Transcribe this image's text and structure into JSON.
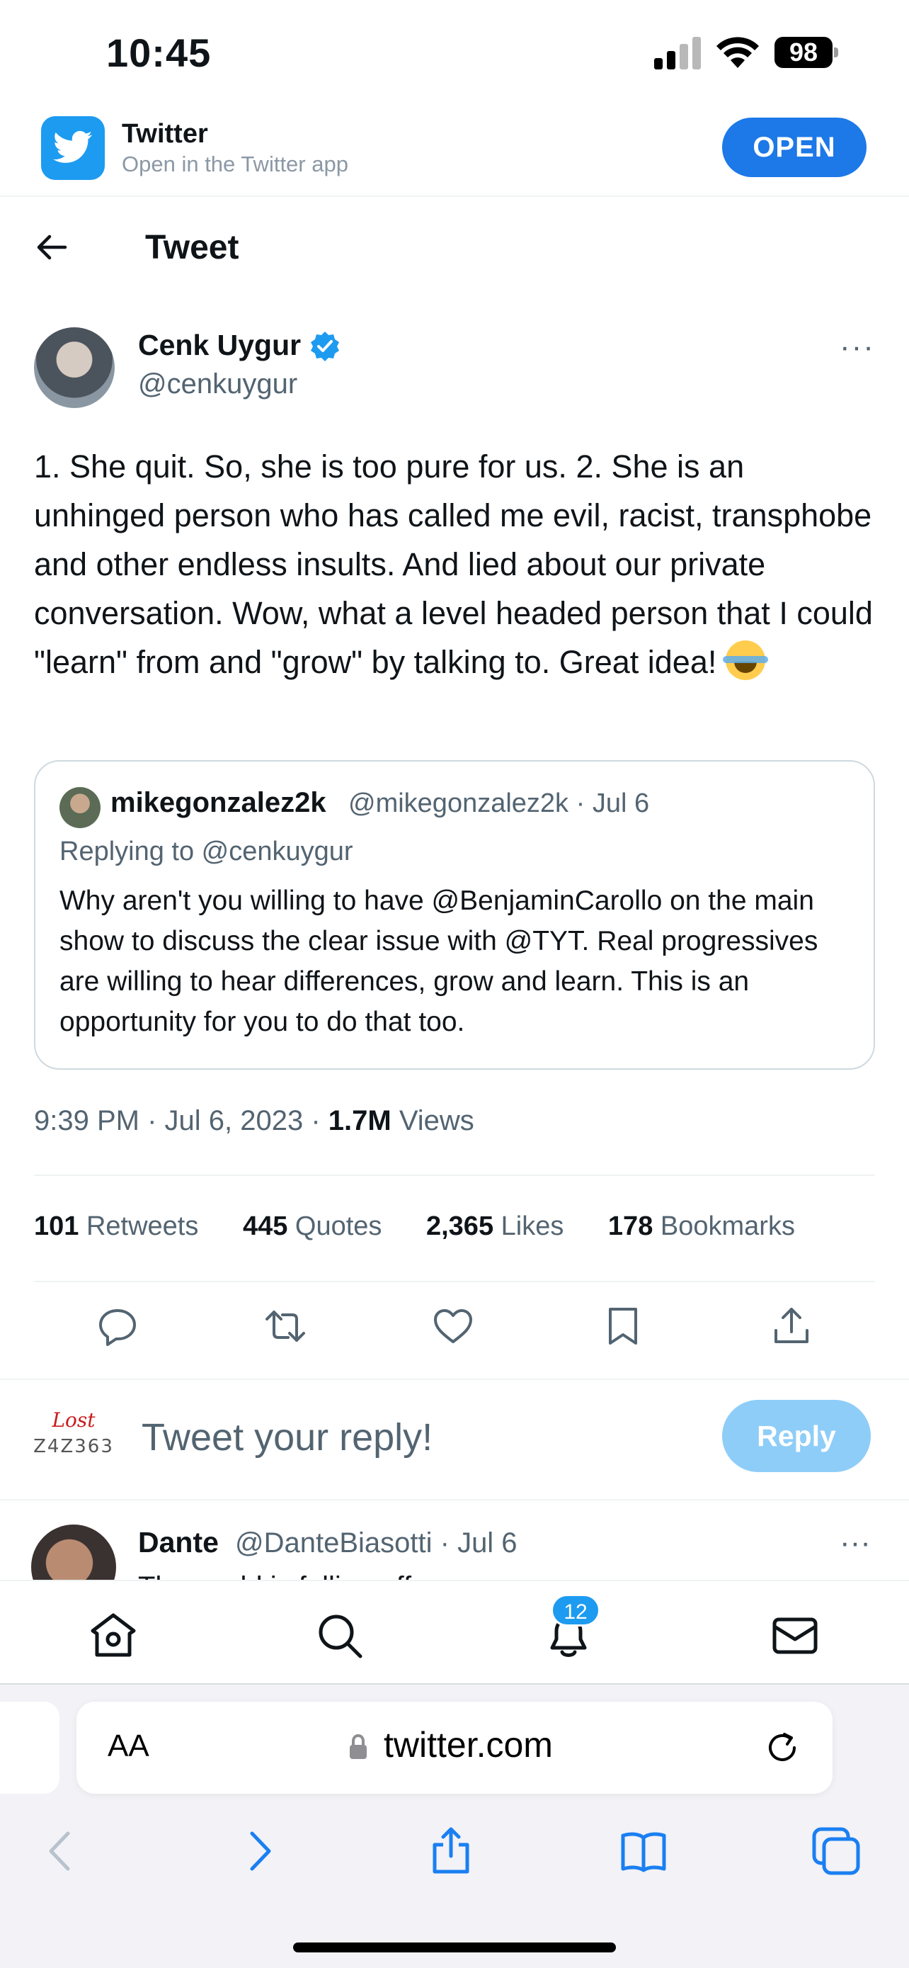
{
  "status_bar": {
    "time": "10:45",
    "battery": "98"
  },
  "app_banner": {
    "title": "Twitter",
    "subtitle": "Open in the Twitter app",
    "open_label": "OPEN"
  },
  "header": {
    "title": "Tweet"
  },
  "tweet": {
    "author_name": "Cenk Uygur",
    "author_handle": "@cenkuygur",
    "more": "···",
    "text": "1. She quit. So, she is too pure for us. 2. She is an unhinged person who has called me evil, racist, transphobe and other endless insults. And lied about our private conversation. Wow, what a level headed person that I could \"learn\" from and \"grow\" by talking to. Great idea!",
    "emoji": "face-with-tears-of-joy",
    "quote": {
      "name": "mikegonzalez2k",
      "handle_date": "@mikegonzalez2k · Jul 6",
      "replying": "Replying to @cenkuygur",
      "text": "Why aren't you willing to have @BenjaminCarollo on the main show to discuss the clear issue with @TYT.  Real progressives are willing to hear differences, grow and learn.  This is an opportunity for you to do that too."
    },
    "timestamp": "9:39 PM · Jul 6, 2023 · ",
    "views_count": "1.7M",
    "views_label": " Views",
    "stats": [
      {
        "count": "101",
        "label": " Retweets"
      },
      {
        "count": "445",
        "label": " Quotes"
      },
      {
        "count": "2,365",
        "label": " Likes"
      },
      {
        "count": "178",
        "label": " Bookmarks"
      }
    ]
  },
  "reply_box": {
    "placeholder": "Tweet your reply!",
    "button": "Reply",
    "avatar_text": "Lost"
  },
  "reply_tweet": {
    "name": "Dante",
    "handle_date": "@DanteBiasotti · Jul 6",
    "more": "···",
    "text": "The world is falling off..."
  },
  "nav": {
    "notifications_badge": "12"
  },
  "safari": {
    "aa": "AA",
    "url": "twitter.com"
  },
  "colors": {
    "brand": "#1d9bf0",
    "open_button": "#1d78e8",
    "reply_button_disabled": "#8ecdf8",
    "muted_text": "#536471"
  }
}
